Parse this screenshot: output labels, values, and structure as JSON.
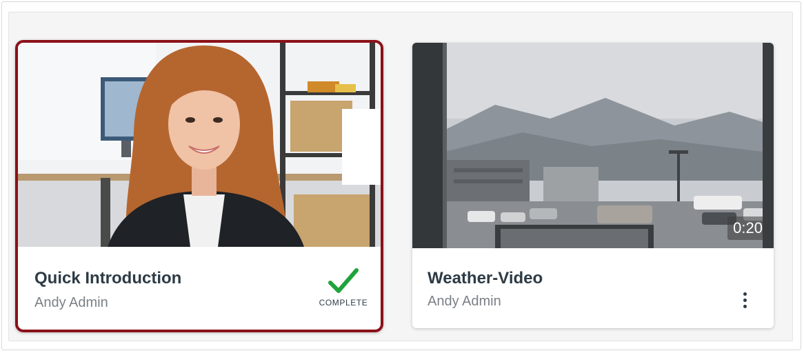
{
  "videos": [
    {
      "title": "Quick Introduction",
      "author": "Andy Admin",
      "status_label": "COMPLETE",
      "selected": true
    },
    {
      "title": "Weather-Video",
      "author": "Andy Admin",
      "duration": "0:20",
      "menu_icon": "more-vertical-icon"
    }
  ],
  "colors": {
    "selected_border": "#8b1118",
    "complete_check": "#1fa33a",
    "title_text": "#2d3b45",
    "author_text": "#7a8086"
  }
}
